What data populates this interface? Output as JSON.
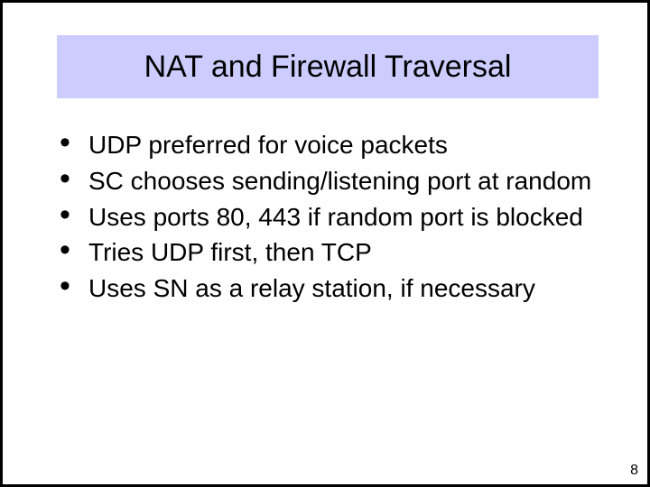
{
  "title": "NAT and Firewall Traversal",
  "bullets": {
    "b0": "UDP preferred for voice packets",
    "b1": "SC chooses sending/listening port at random",
    "b2": "Uses ports 80, 443 if random port is blocked",
    "b3": "Tries UDP first, then TCP",
    "b4": "Uses SN as a relay station, if necessary"
  },
  "page_number": "8"
}
